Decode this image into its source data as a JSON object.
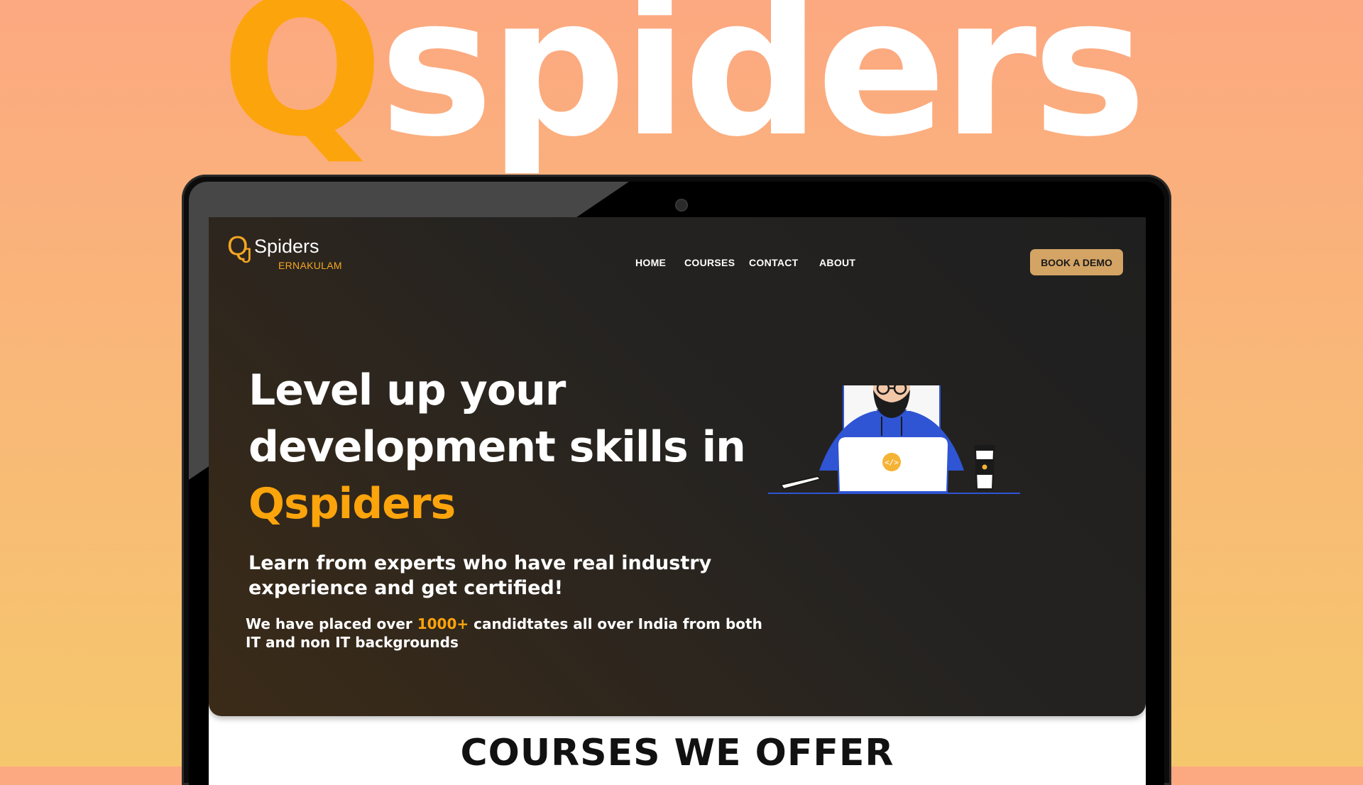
{
  "banner": {
    "logo_q": "Q",
    "logo_rest": "spiders"
  },
  "site": {
    "logo": {
      "q": "Q",
      "j": "J",
      "name": "Spiders",
      "location": "ERNAKULAM"
    },
    "nav": {
      "items": [
        "HOME",
        "COURSES",
        "CONTACT",
        "ABOUT"
      ],
      "cta": "BOOK A DEMO"
    },
    "hero": {
      "headline_line1": "Level up your",
      "headline_line2": "development skills in",
      "headline_accent": "Qspiders",
      "subheading_line1": "Learn from experts who have real industry",
      "subheading_line2": "experience and get certified!",
      "placed_prefix": "We have placed over ",
      "placed_count": "1000+",
      "placed_suffix": " candidtates all over India from both",
      "placed_line2": "IT and non IT backgrounds",
      "laptop_code_icon": "</>"
    },
    "courses": {
      "title": "COURSES WE OFFER"
    }
  },
  "colors": {
    "accent": "#fca40c",
    "cta_bg": "#d4a465",
    "hero_bg": "#252321",
    "illustration_blue": "#2f55d4"
  },
  "icons": [
    "webcam-icon",
    "code-icon",
    "coffee-cup-icon",
    "phone-icon"
  ]
}
